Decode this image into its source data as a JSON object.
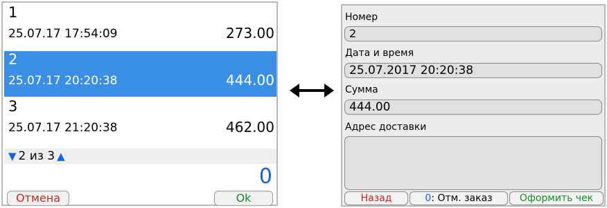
{
  "left_screen": {
    "orders": [
      {
        "number": "1",
        "datetime": "25.07.17 17:54:09",
        "sum": "273.00",
        "selected": false
      },
      {
        "number": "2",
        "datetime": "25.07.17 20:20:38",
        "sum": "444.00",
        "selected": true
      },
      {
        "number": "3",
        "datetime": "25.07.17 21:20:38",
        "sum": "462.00",
        "selected": false
      }
    ],
    "pager": {
      "text": "2 из 3",
      "down_icon": "triangle-down-icon",
      "up_icon": "triangle-up-icon"
    },
    "counter": "0",
    "cancel_label": "Отмена",
    "ok_label": "Ok"
  },
  "arrow_icon": "double-arrow-icon",
  "right_screen": {
    "number_label": "Номер",
    "number_value": "2",
    "datetime_label": "Дата и время",
    "datetime_value": "25.07.2017 20:20:38",
    "sum_label": "Сумма",
    "sum_value": "444.00",
    "address_label": "Адрес доставки",
    "address_value": "",
    "back_label": "Назад",
    "cancel_order_key": "0",
    "cancel_order_label": ": Отм. заказ",
    "checkout_label": "Оформить чек"
  },
  "colors": {
    "selection": "#3a8ee6",
    "accent_blue": "#1a5fe0",
    "cancel_red": "#c62828",
    "ok_green": "#1c8a2a"
  }
}
